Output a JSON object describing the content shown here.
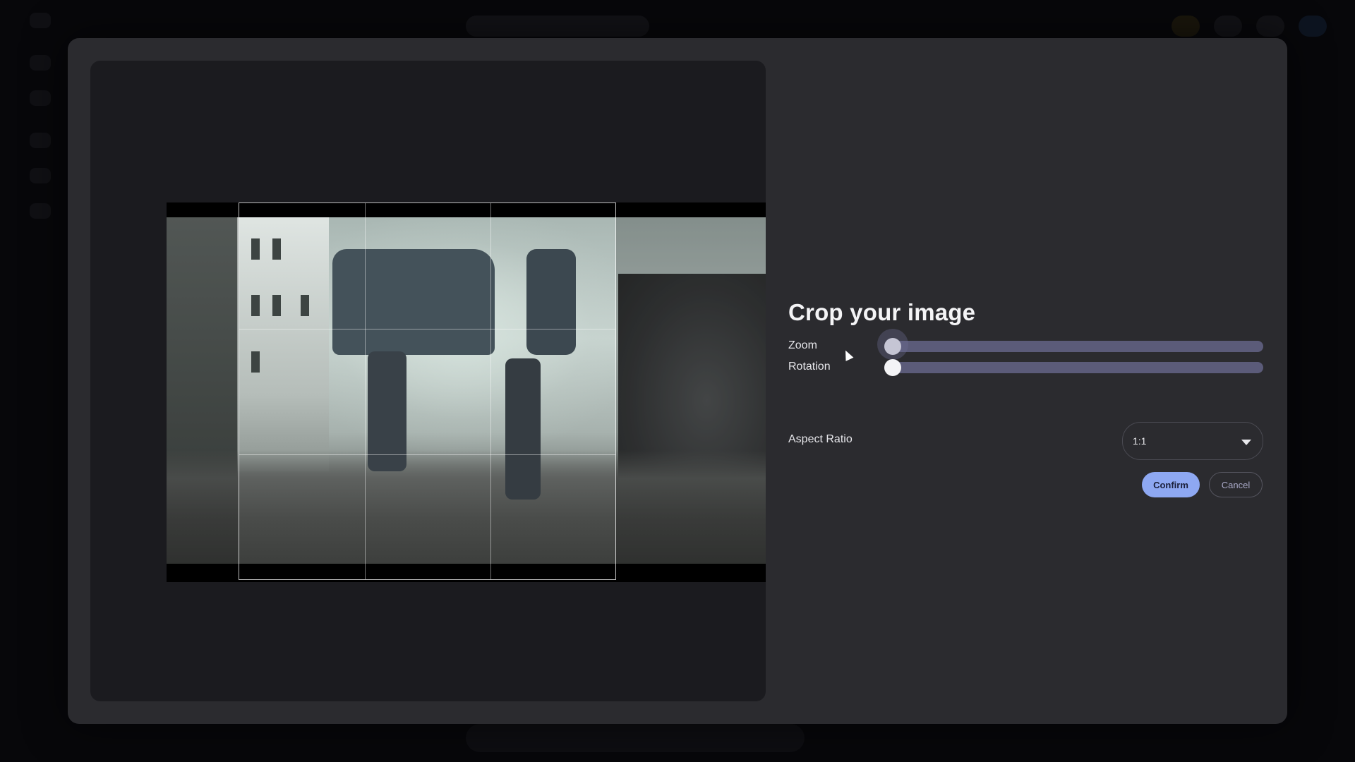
{
  "modal": {
    "title": "Crop your image",
    "zoom": {
      "label": "Zoom",
      "value_fraction": 0.0
    },
    "rotation": {
      "label": "Rotation",
      "value_fraction": 0.0
    },
    "aspect_ratio": {
      "label": "Aspect Ratio",
      "selected": "1:1"
    },
    "confirm_label": "Confirm",
    "cancel_label": "Cancel"
  },
  "colors": {
    "accent": "#8ea8f2",
    "slider_track": "#5b5b79",
    "modal_bg": "#2b2b2f"
  },
  "icons": {
    "dropdown": "chevron-down-icon",
    "pointer": "cursor-icon"
  }
}
